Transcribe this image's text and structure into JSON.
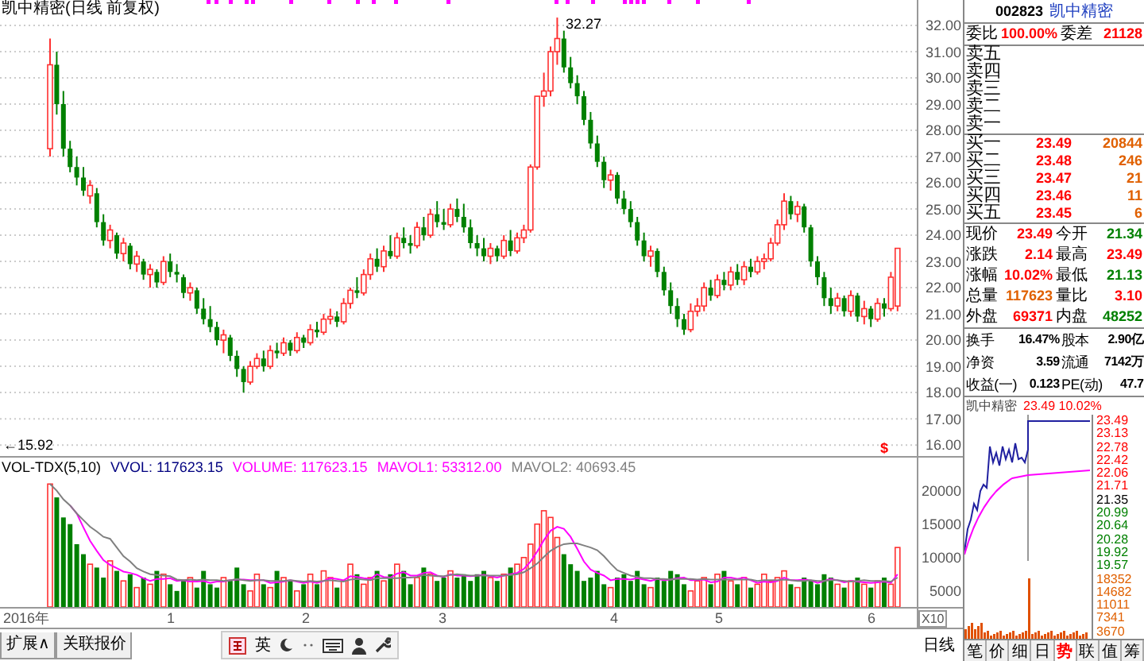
{
  "title": "凯中精密(日线 前复权)",
  "price_chart": {
    "chart_data": {
      "type": "candlestick",
      "ylim": [
        15.58,
        32.97
      ],
      "grid": true,
      "yticks": [
        {
          "value": 32,
          "label": "32.00"
        },
        {
          "value": 31,
          "label": "31.00"
        },
        {
          "value": 30,
          "label": "30.00"
        },
        {
          "value": 29,
          "label": "29.00"
        },
        {
          "value": 28,
          "label": "28.00"
        },
        {
          "value": 27,
          "label": "27.00"
        },
        {
          "value": 26,
          "label": "26.00"
        },
        {
          "value": 25,
          "label": "25.00"
        },
        {
          "value": 24,
          "label": "24.00"
        },
        {
          "value": 23,
          "label": "23.00"
        },
        {
          "value": 22,
          "label": "22.00"
        },
        {
          "value": 21,
          "label": "21.00"
        },
        {
          "value": 20,
          "label": "20.00"
        },
        {
          "value": 19,
          "label": "19.00"
        },
        {
          "value": 18,
          "label": "18.00"
        },
        {
          "value": 17,
          "label": "17.00"
        },
        {
          "value": 16,
          "label": "16.00"
        }
      ],
      "ohlc": [
        [
          27.3,
          31.5,
          27.0,
          30.5
        ],
        [
          30.5,
          31.0,
          28.6,
          29.0
        ],
        [
          29.0,
          29.5,
          27.0,
          27.3
        ],
        [
          27.3,
          27.6,
          26.4,
          26.6
        ],
        [
          26.6,
          27.0,
          25.9,
          26.2
        ],
        [
          26.2,
          26.6,
          25.5,
          25.7
        ],
        [
          25.5,
          26.1,
          25.2,
          25.9
        ],
        [
          25.6,
          25.8,
          24.3,
          24.5
        ],
        [
          24.5,
          24.8,
          23.6,
          23.8
        ],
        [
          23.8,
          24.4,
          23.5,
          24.2
        ],
        [
          24.0,
          24.1,
          23.1,
          23.3
        ],
        [
          23.3,
          23.9,
          23.0,
          23.7
        ],
        [
          23.6,
          23.7,
          22.7,
          22.9
        ],
        [
          22.9,
          23.4,
          22.6,
          23.2
        ],
        [
          23.0,
          23.1,
          22.3,
          22.5
        ],
        [
          22.5,
          22.9,
          22.0,
          22.7
        ],
        [
          22.6,
          22.7,
          22.0,
          22.2
        ],
        [
          22.2,
          23.2,
          22.1,
          23.0
        ],
        [
          23.0,
          23.3,
          22.4,
          22.6
        ],
        [
          22.6,
          22.9,
          22.2,
          22.5
        ],
        [
          22.4,
          22.5,
          21.6,
          21.8
        ],
        [
          21.8,
          22.2,
          21.5,
          22.0
        ],
        [
          21.9,
          22.0,
          21.0,
          21.2
        ],
        [
          21.2,
          21.6,
          20.6,
          20.8
        ],
        [
          20.8,
          21.3,
          20.3,
          20.5
        ],
        [
          20.5,
          20.7,
          19.8,
          20.0
        ],
        [
          20.0,
          20.4,
          19.5,
          20.2
        ],
        [
          20.1,
          20.2,
          19.2,
          19.4
        ],
        [
          19.4,
          19.6,
          18.6,
          18.9
        ],
        [
          18.9,
          19.0,
          18.0,
          18.4
        ],
        [
          18.4,
          19.2,
          18.3,
          19.0
        ],
        [
          19.0,
          19.5,
          18.9,
          19.3
        ],
        [
          19.3,
          19.6,
          18.8,
          19.0
        ],
        [
          19.0,
          19.8,
          18.9,
          19.6
        ],
        [
          19.6,
          19.9,
          19.3,
          19.5
        ],
        [
          19.5,
          20.1,
          19.4,
          19.9
        ],
        [
          19.9,
          20.0,
          19.4,
          19.6
        ],
        [
          19.6,
          20.3,
          19.5,
          20.1
        ],
        [
          20.1,
          20.2,
          19.7,
          19.9
        ],
        [
          19.9,
          20.6,
          19.8,
          20.4
        ],
        [
          20.4,
          20.7,
          20.1,
          20.3
        ],
        [
          20.3,
          21.0,
          20.2,
          20.8
        ],
        [
          20.8,
          21.2,
          20.6,
          20.9
        ],
        [
          20.9,
          21.1,
          20.5,
          20.7
        ],
        [
          20.7,
          21.6,
          20.6,
          21.4
        ],
        [
          21.4,
          22.0,
          21.2,
          21.9
        ],
        [
          21.9,
          22.4,
          21.6,
          21.8
        ],
        [
          21.8,
          22.7,
          21.7,
          22.5
        ],
        [
          22.5,
          23.3,
          22.3,
          23.1
        ],
        [
          23.1,
          23.5,
          22.6,
          22.8
        ],
        [
          22.8,
          23.6,
          22.6,
          23.4
        ],
        [
          23.4,
          24.0,
          23.1,
          23.2
        ],
        [
          23.2,
          24.1,
          23.1,
          23.9
        ],
        [
          23.9,
          24.3,
          23.5,
          23.7
        ],
        [
          23.7,
          24.0,
          23.3,
          23.6
        ],
        [
          23.6,
          24.5,
          23.5,
          24.3
        ],
        [
          24.3,
          24.7,
          23.8,
          24.0
        ],
        [
          24.0,
          25.0,
          23.9,
          24.8
        ],
        [
          24.8,
          25.3,
          24.3,
          24.5
        ],
        [
          24.5,
          25.0,
          24.2,
          24.4
        ],
        [
          24.4,
          25.2,
          24.3,
          25.0
        ],
        [
          25.0,
          25.4,
          24.5,
          24.7
        ],
        [
          24.7,
          25.2,
          24.1,
          24.3
        ],
        [
          24.3,
          24.6,
          23.5,
          23.7
        ],
        [
          23.7,
          24.0,
          23.2,
          23.5
        ],
        [
          23.5,
          23.9,
          23.0,
          23.2
        ],
        [
          23.2,
          23.7,
          22.9,
          23.5
        ],
        [
          23.5,
          23.6,
          23.0,
          23.2
        ],
        [
          23.2,
          24.0,
          23.1,
          23.8
        ],
        [
          23.8,
          24.2,
          23.2,
          23.4
        ],
        [
          23.4,
          24.1,
          23.3,
          23.9
        ],
        [
          23.9,
          24.4,
          23.7,
          24.2
        ],
        [
          24.2,
          26.7,
          24.1,
          26.6
        ],
        [
          26.6,
          29.3,
          26.5,
          29.3
        ],
        [
          29.3,
          30.2,
          28.9,
          29.5
        ],
        [
          29.5,
          31.2,
          29.3,
          31.0
        ],
        [
          31.0,
          32.3,
          30.5,
          31.5
        ],
        [
          31.5,
          31.8,
          30.2,
          30.4
        ],
        [
          30.4,
          30.8,
          29.6,
          29.8
        ],
        [
          29.8,
          30.1,
          29.0,
          29.3
        ],
        [
          29.3,
          29.5,
          28.2,
          28.4
        ],
        [
          28.4,
          28.7,
          27.3,
          27.5
        ],
        [
          27.5,
          27.8,
          26.6,
          26.8
        ],
        [
          26.8,
          27.0,
          25.8,
          26.1
        ],
        [
          26.1,
          26.5,
          25.7,
          26.3
        ],
        [
          26.3,
          26.4,
          25.2,
          25.4
        ],
        [
          25.4,
          25.7,
          24.8,
          25.0
        ],
        [
          25.0,
          25.3,
          24.3,
          24.5
        ],
        [
          24.5,
          24.7,
          23.6,
          23.8
        ],
        [
          23.8,
          24.1,
          23.0,
          23.2
        ],
        [
          23.2,
          23.6,
          22.8,
          23.4
        ],
        [
          23.4,
          23.5,
          22.4,
          22.6
        ],
        [
          22.6,
          22.8,
          21.7,
          21.9
        ],
        [
          21.9,
          22.2,
          21.0,
          21.3
        ],
        [
          21.3,
          21.6,
          20.5,
          20.8
        ],
        [
          20.8,
          21.0,
          20.2,
          20.4
        ],
        [
          20.4,
          21.4,
          20.3,
          21.1
        ],
        [
          21.1,
          21.6,
          20.9,
          21.3
        ],
        [
          21.3,
          22.2,
          21.1,
          22.0
        ],
        [
          22.0,
          22.3,
          21.5,
          21.7
        ],
        [
          21.7,
          22.5,
          21.6,
          22.3
        ],
        [
          22.3,
          22.6,
          21.9,
          22.1
        ],
        [
          22.1,
          22.8,
          21.9,
          22.6
        ],
        [
          22.6,
          22.9,
          22.1,
          22.3
        ],
        [
          22.3,
          23.0,
          22.1,
          22.8
        ],
        [
          22.8,
          23.1,
          22.4,
          22.6
        ],
        [
          22.6,
          23.2,
          22.5,
          23.0
        ],
        [
          23.0,
          23.3,
          22.7,
          23.1
        ],
        [
          23.1,
          23.9,
          23.0,
          23.7
        ],
        [
          23.7,
          24.6,
          23.6,
          24.4
        ],
        [
          24.4,
          25.6,
          24.2,
          25.3
        ],
        [
          25.3,
          25.5,
          24.6,
          24.8
        ],
        [
          24.8,
          25.3,
          24.5,
          25.1
        ],
        [
          25.1,
          25.2,
          24.1,
          24.3
        ],
        [
          24.3,
          24.4,
          22.8,
          23.0
        ],
        [
          23.0,
          23.2,
          22.1,
          22.4
        ],
        [
          22.4,
          22.6,
          21.3,
          21.6
        ],
        [
          21.6,
          22.0,
          21.0,
          21.3
        ],
        [
          21.3,
          21.8,
          21.1,
          21.6
        ],
        [
          21.6,
          21.7,
          20.9,
          21.1
        ],
        [
          21.1,
          21.9,
          20.9,
          21.7
        ],
        [
          21.7,
          21.8,
          20.7,
          20.9
        ],
        [
          20.9,
          21.5,
          20.6,
          21.2
        ],
        [
          21.2,
          21.3,
          20.5,
          20.8
        ],
        [
          20.8,
          21.6,
          20.7,
          21.4
        ],
        [
          21.4,
          21.6,
          20.9,
          21.2
        ],
        [
          21.2,
          22.6,
          21.1,
          22.4
        ],
        [
          21.3,
          23.5,
          21.1,
          23.5
        ]
      ]
    }
  },
  "annotations": [
    {
      "kind": "high",
      "text": "32.27"
    },
    {
      "kind": "low",
      "text": "←15.92"
    },
    {
      "kind": "flag",
      "text": "$"
    }
  ],
  "volume": {
    "indicator": "VOL-TDX(5,10)",
    "readings": [
      {
        "text": "VVOL: 117623.15",
        "color": "#000080"
      },
      {
        "text": "VOLUME: 117623.15",
        "color": "#ff00ff"
      },
      {
        "text": "MAVOL1: 53312.00",
        "color": "#ff00ff"
      },
      {
        "text": "MAVOL2: 40693.45",
        "color": "#808080"
      }
    ],
    "scale": "X10",
    "chart_data": {
      "type": "bar",
      "ylim": [
        2600,
        22100
      ],
      "yticks": [
        20000,
        15000,
        10000,
        5000
      ],
      "series": [
        {
          "type": "bar",
          "colors": [
            "#ff3030",
            "#008000",
            "#008000",
            "#008000",
            "#008000",
            "#008000",
            "#ff3030",
            "#008000",
            "#008000",
            "#ff3030",
            "#008000",
            "#ff3030",
            "#008000",
            "#ff3030",
            "#008000",
            "#ff3030",
            "#008000",
            "#ff3030",
            "#008000",
            "#008000",
            "#008000",
            "#ff3030",
            "#008000",
            "#008000",
            "#008000",
            "#008000",
            "#ff3030",
            "#008000",
            "#008000",
            "#008000",
            "#ff3030",
            "#ff3030",
            "#008000",
            "#ff3030",
            "#008000",
            "#ff3030",
            "#008000",
            "#ff3030",
            "#008000",
            "#ff3030",
            "#008000",
            "#ff3030",
            "#ff3030",
            "#008000",
            "#ff3030",
            "#ff3030",
            "#008000",
            "#ff3030",
            "#ff3030",
            "#008000",
            "#ff3030",
            "#008000",
            "#ff3030",
            "#008000",
            "#008000",
            "#ff3030",
            "#008000",
            "#ff3030",
            "#008000",
            "#008000",
            "#ff3030",
            "#008000",
            "#008000",
            "#008000",
            "#008000",
            "#008000",
            "#ff3030",
            "#008000",
            "#ff3030",
            "#008000",
            "#ff3030",
            "#ff3030",
            "#ff3030",
            "#ff3030",
            "#ff3030",
            "#ff3030",
            "#ff3030",
            "#008000",
            "#008000",
            "#008000",
            "#008000",
            "#008000",
            "#008000",
            "#008000",
            "#ff3030",
            "#008000",
            "#008000",
            "#008000",
            "#008000",
            "#008000",
            "#ff3030",
            "#008000",
            "#008000",
            "#008000",
            "#008000",
            "#008000",
            "#ff3030",
            "#ff3030",
            "#ff3030",
            "#008000",
            "#ff3030",
            "#008000",
            "#ff3030",
            "#008000",
            "#ff3030",
            "#008000",
            "#ff3030",
            "#ff3030",
            "#ff3030",
            "#ff3030",
            "#ff3030",
            "#008000",
            "#ff3030",
            "#008000",
            "#008000",
            "#008000",
            "#008000",
            "#008000",
            "#ff3030",
            "#008000",
            "#ff3030",
            "#008000",
            "#ff3030",
            "#008000",
            "#ff3030",
            "#008000",
            "#ff3030",
            "#ff3030"
          ],
          "values": [
            21000,
            19000,
            16000,
            15000,
            12000,
            10500,
            9000,
            8500,
            7000,
            9500,
            8000,
            6500,
            7500,
            5500,
            7000,
            6000,
            8000,
            7500,
            6000,
            5000,
            6500,
            7000,
            5500,
            8000,
            6000,
            5500,
            7000,
            6500,
            8500,
            6000,
            5000,
            7500,
            6000,
            5500,
            8000,
            7000,
            6500,
            5000,
            6000,
            7500,
            6000,
            8000,
            7000,
            5500,
            6500,
            9000,
            7500,
            6000,
            7000,
            8000,
            6500,
            7500,
            9000,
            8000,
            6000,
            7000,
            8500,
            7500,
            6500,
            7000,
            8000,
            7000,
            7500,
            6500,
            7500,
            8000,
            7000,
            6500,
            7500,
            8500,
            9000,
            10000,
            12000,
            15000,
            17000,
            16000,
            13000,
            10500,
            9000,
            8000,
            6500,
            7000,
            8000,
            6000,
            5500,
            7000,
            7500,
            6500,
            8000,
            6000,
            5500,
            7000,
            6500,
            8000,
            7500,
            6000,
            5000,
            6500,
            7000,
            6000,
            7500,
            8000,
            6500,
            6000,
            7000,
            5500,
            6000,
            7500,
            6500,
            7000,
            8000,
            6000,
            5500,
            7000,
            6500,
            6000,
            7500,
            7000,
            6000,
            5500,
            6500,
            7000,
            6000,
            5500,
            6500,
            7000,
            6000,
            11500
          ]
        },
        {
          "type": "line",
          "color": "#ff00ff",
          "values": [
            null,
            null,
            null,
            17800,
            16600,
            14500,
            12500,
            11000,
            9600,
            8900,
            8400,
            7900,
            7700,
            7400,
            6900,
            6500,
            6800,
            6800,
            6900,
            6500,
            6600,
            6400,
            6400,
            6500,
            6200,
            6400,
            6400,
            6600,
            6700,
            6700,
            6600,
            6600,
            6600,
            6200,
            6300,
            6400,
            6600,
            6400,
            6200,
            6400,
            6200,
            6500,
            6900,
            6800,
            6600,
            7200,
            7100,
            6900,
            6800,
            7500,
            7100,
            7000,
            7600,
            7800,
            7300,
            7300,
            7700,
            7800,
            7300,
            7100,
            7500,
            7300,
            7300,
            7200,
            7300,
            7400,
            7200,
            7000,
            7300,
            7500,
            7700,
            8300,
            9400,
            10900,
            12600,
            14000,
            14600,
            14300,
            13100,
            11300,
            9400,
            8200,
            7700,
            7300,
            6600,
            6800,
            6800,
            6700,
            6900,
            6700,
            6500,
            6800,
            6600,
            6700,
            6900,
            7000,
            6600,
            6600,
            6700,
            6300,
            6400,
            7000,
            7000,
            6800,
            7000,
            6600,
            6200,
            6400,
            6300,
            6500,
            7000,
            6600,
            6600,
            6700,
            6600,
            6200,
            6500,
            6800,
            6600,
            6300,
            6500,
            6400,
            6300,
            6200,
            6300,
            6400,
            6200,
            7500
          ]
        },
        {
          "type": "line",
          "color": "#808080",
          "values": [
            21000,
            20000,
            18700,
            17800,
            16600,
            15600,
            14600,
            13900,
            13100,
            12800,
            11500,
            10200,
            9400,
            8400,
            7900,
            7500,
            7400,
            7300,
            7200,
            6700,
            6600,
            6700,
            6600,
            6700,
            6600,
            6600,
            6500,
            6600,
            6800,
            6600,
            6500,
            6600,
            6600,
            6500,
            6500,
            6500,
            6600,
            6500,
            6400,
            6500,
            6400,
            6500,
            6600,
            6500,
            6400,
            6700,
            6800,
            6700,
            6600,
            6900,
            6900,
            6900,
            6900,
            7000,
            7000,
            7100,
            7400,
            7300,
            7200,
            7200,
            7400,
            7500,
            7400,
            7300,
            7300,
            7300,
            7300,
            7300,
            7300,
            7400,
            7500,
            7800,
            8400,
            9100,
            10100,
            11000,
            11600,
            12000,
            12100,
            12100,
            11800,
            11500,
            11100,
            10200,
            9100,
            8100,
            7700,
            7300,
            7100,
            6900,
            6900,
            6800,
            6800,
            6700,
            6800,
            6800,
            6800,
            6700,
            6800,
            6700,
            6700,
            6700,
            6700,
            6700,
            6700,
            6700,
            6500,
            6600,
            6600,
            6600,
            6700,
            6600,
            6500,
            6500,
            6600,
            6500,
            6500,
            6600,
            6600,
            6500,
            6400,
            6500,
            6600,
            6500,
            6500,
            6500,
            6400,
            7000
          ]
        }
      ]
    }
  },
  "date_axis": [
    "2016年",
    "1",
    "2",
    "3",
    "4",
    "5",
    "6"
  ],
  "period_label": "日线",
  "bottom_tabs": [
    "扩展∧",
    "关联报价"
  ],
  "ime_label": "英",
  "quote": {
    "code": "002823",
    "name": "凯中精密",
    "commission": [
      {
        "label": "委比",
        "value": "100.00%",
        "color": "#ff0000"
      },
      {
        "label": "委差",
        "value": "21128",
        "color": "#ff0000"
      }
    ],
    "asks": [
      {
        "label": "卖五"
      },
      {
        "label": "卖四"
      },
      {
        "label": "卖三"
      },
      {
        "label": "卖二"
      },
      {
        "label": "卖一"
      }
    ],
    "bids": [
      {
        "label": "买一",
        "price": "23.49",
        "volume": "20844"
      },
      {
        "label": "买二",
        "price": "23.48",
        "volume": "246"
      },
      {
        "label": "买三",
        "price": "23.47",
        "volume": "21"
      },
      {
        "label": "买四",
        "price": "23.46",
        "volume": "11"
      },
      {
        "label": "买五",
        "price": "23.45",
        "volume": "6"
      }
    ],
    "stats": [
      {
        "label": "现价",
        "value": "23.49",
        "color": "#ff0000"
      },
      {
        "label": "今开",
        "value": "21.34",
        "color": "#008000"
      },
      {
        "label": "涨跌",
        "value": "2.14",
        "color": "#ff0000"
      },
      {
        "label": "最高",
        "value": "23.49",
        "color": "#ff0000"
      },
      {
        "label": "涨幅",
        "value": "10.02%",
        "color": "#ff0000"
      },
      {
        "label": "最低",
        "value": "21.13",
        "color": "#008000"
      },
      {
        "label": "总量",
        "value": "117623",
        "color": "#e06000"
      },
      {
        "label": "量比",
        "value": "3.10",
        "color": "#ff0000"
      },
      {
        "label": "外盘",
        "value": "69371",
        "color": "#ff0000"
      },
      {
        "label": "内盘",
        "value": "48252",
        "color": "#008000"
      }
    ],
    "fundamentals": [
      {
        "label": "换手",
        "value": "16.47%"
      },
      {
        "label": "股本",
        "value": "2.90亿"
      },
      {
        "label": "净资",
        "value": "3.59"
      },
      {
        "label": "流通",
        "value": "7142万"
      },
      {
        "label": "收益(一)",
        "value": "0.123"
      },
      {
        "label": "PE(动)",
        "value": "47.7"
      }
    ]
  },
  "intraday": {
    "name": "凯中精密",
    "reading": "23.49 10.02%",
    "price_axis": [
      {
        "text": "23.49",
        "color": "#ff0000"
      },
      {
        "text": "23.13",
        "color": "#ff0000"
      },
      {
        "text": "22.78",
        "color": "#ff0000"
      },
      {
        "text": "22.42",
        "color": "#ff0000"
      },
      {
        "text": "22.06",
        "color": "#ff0000"
      },
      {
        "text": "21.71",
        "color": "#ff0000"
      },
      {
        "text": "21.35",
        "color": "#000000"
      },
      {
        "text": "20.99",
        "color": "#008000"
      },
      {
        "text": "20.64",
        "color": "#008000"
      },
      {
        "text": "20.28",
        "color": "#008000"
      },
      {
        "text": "19.92",
        "color": "#008000"
      },
      {
        "text": "19.57",
        "color": "#008000"
      }
    ],
    "volume_axis": [
      "18352",
      "14682",
      "11011",
      "7341",
      "3670"
    ]
  },
  "panel_tabs": [
    {
      "label": "笔",
      "selected": false
    },
    {
      "label": "价",
      "selected": false
    },
    {
      "label": "细",
      "selected": false
    },
    {
      "label": "日",
      "selected": false
    },
    {
      "label": "势",
      "selected": true
    },
    {
      "label": "联",
      "selected": false
    },
    {
      "label": "值",
      "selected": false
    },
    {
      "label": "筹",
      "selected": false
    }
  ]
}
